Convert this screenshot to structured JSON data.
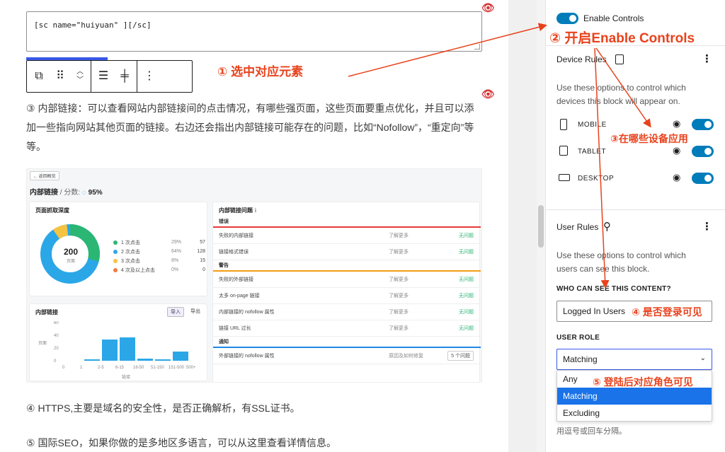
{
  "editor": {
    "shortcode": "[sc name=\"huiyuan\" ][/sc]",
    "para_internal_links": "③ 内部链接：可以查看网站内部链接间的点击情况，有哪些强页面，这些页面要重点优化，并且可以添加一些指向网站其他页面的链接。右边还会指出内部链接可能存在的问题，比如“Nofollow”，“重定向”等等。",
    "para_https": "④ HTTPS,主要是域名的安全性，是否正确解析，有SSL证书。",
    "para_intl_seo": "⑤ 国际SEO，如果你做的是多地区多语言，可以从这里查看详情信息。"
  },
  "screenshot": {
    "back": "← 返回概览",
    "title": "内部链接",
    "score_label": "/ 分数:",
    "score": "95%",
    "depth_title": "页面抓取深度",
    "donut_value": "200",
    "donut_sub": "页面",
    "legend": [
      {
        "label": "1 次点击",
        "pct": "29%",
        "count": "57",
        "color": "#2bb673"
      },
      {
        "label": "2 次点击",
        "pct": "64%",
        "count": "128",
        "color": "#2ba7e8"
      },
      {
        "label": "3 次点击",
        "pct": "8%",
        "count": "15",
        "color": "#f5c342"
      },
      {
        "label": "4 次及以上点击",
        "pct": "0%",
        "count": "0",
        "color": "#f07b3f"
      }
    ],
    "links_title": "内部链接",
    "import_btn": "导入",
    "export_btn": "导出",
    "bar_axis": [
      "0",
      "1",
      "2-5",
      "6-15",
      "16-50",
      "51-150",
      "151-500",
      "500+"
    ],
    "bar_y": [
      "60",
      "40",
      "20",
      "0"
    ],
    "bar_xlabel": "链接",
    "bar_ylabel": "页面",
    "issues_title": "内部链接问题",
    "sections": [
      {
        "name": "错误",
        "color": "#e53935",
        "rows": [
          {
            "label": "失败的内部链接",
            "more": "了解更多",
            "status": "无问题"
          },
          {
            "label": "链接格式错误",
            "more": "了解更多",
            "status": "无问题"
          }
        ]
      },
      {
        "name": "警告",
        "color": "#f39c12",
        "rows": [
          {
            "label": "失败的外部链接",
            "more": "了解更多",
            "status": "无问题"
          },
          {
            "label": "太多 on-page 链接",
            "more": "了解更多",
            "status": "无问题"
          },
          {
            "label": "内部链接的 nofollow 属性",
            "more": "了解更多",
            "status": "无问题"
          },
          {
            "label": "链接 URL 过长",
            "more": "了解更多",
            "status": "无问题"
          }
        ]
      },
      {
        "name": "通知",
        "color": "#1e88e5",
        "rows": [
          {
            "label": "外部链接的 nofollow 属性",
            "more": "原因及如何修复",
            "status": "5 个问题"
          }
        ]
      }
    ]
  },
  "sidebar": {
    "enable_controls": "Enable Controls",
    "device_rules": "Device Rules",
    "device_desc": "Use these options to control which devices this block will appear on.",
    "devices": [
      {
        "name": "MOBILE"
      },
      {
        "name": "TABLET"
      },
      {
        "name": "DESKTOP"
      }
    ],
    "user_rules": "User Rules",
    "user_desc": "Use these options to control which users can see this block.",
    "who_label": "WHO CAN SEE THIS CONTENT?",
    "who_value": "Logged In Users",
    "role_label": "USER ROLE",
    "role_value": "Matching",
    "role_options": [
      "Any",
      "Matching",
      "Excluding"
    ],
    "hint": "用逗号或回车分隔。"
  },
  "annotations": {
    "a1": "① 选中对应元素",
    "a2": "② 开启Enable Controls",
    "a3": "③在哪些设备应用",
    "a4": "④ 是否登录可见",
    "a5": "⑤ 登陆后对应角色可见"
  },
  "colors": {
    "accent": "#007cba",
    "annotation": "#e8421c",
    "selected": "#1a73e8"
  }
}
